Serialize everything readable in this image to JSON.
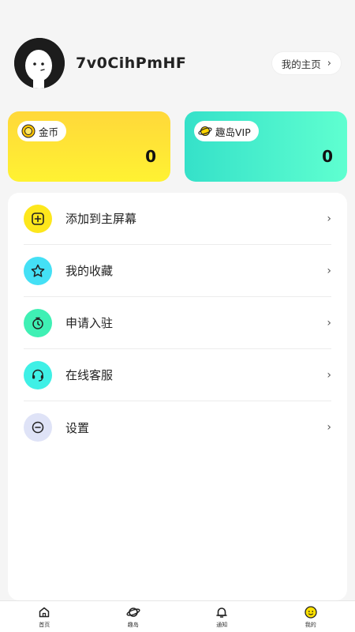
{
  "profile": {
    "username": "7v0CihPmHF",
    "home_link": "我的主页",
    "home_chevron": "›"
  },
  "cards": {
    "coin": {
      "label": "金币",
      "value": "0",
      "icon": "coin-icon",
      "color": "#ffe033"
    },
    "vip": {
      "label": "趣岛VIP",
      "value": "0",
      "icon": "planet-icon",
      "color": "#4cf2cc"
    }
  },
  "menu": [
    {
      "label": "添加到主屏幕",
      "icon": "add-to-home-icon",
      "color": "#fdea1f",
      "arrow": "›"
    },
    {
      "label": "我的收藏",
      "icon": "star-icon",
      "color": "#44e0f5",
      "arrow": "›"
    },
    {
      "label": "申请入驻",
      "icon": "stopwatch-icon",
      "color": "#3ff0b4",
      "arrow": "›"
    },
    {
      "label": "在线客服",
      "icon": "headset-icon",
      "color": "#3ff0e6",
      "arrow": "›"
    },
    {
      "label": "设置",
      "icon": "settings-icon",
      "color": "#dfe3f7",
      "arrow": "›"
    }
  ],
  "tabbar": [
    {
      "label": "首页",
      "icon": "home-icon"
    },
    {
      "label": "趣岛",
      "icon": "planet-icon"
    },
    {
      "label": "通知",
      "icon": "bell-icon"
    },
    {
      "label": "我的",
      "icon": "smiley-icon",
      "active_color": "#ffe100"
    }
  ]
}
